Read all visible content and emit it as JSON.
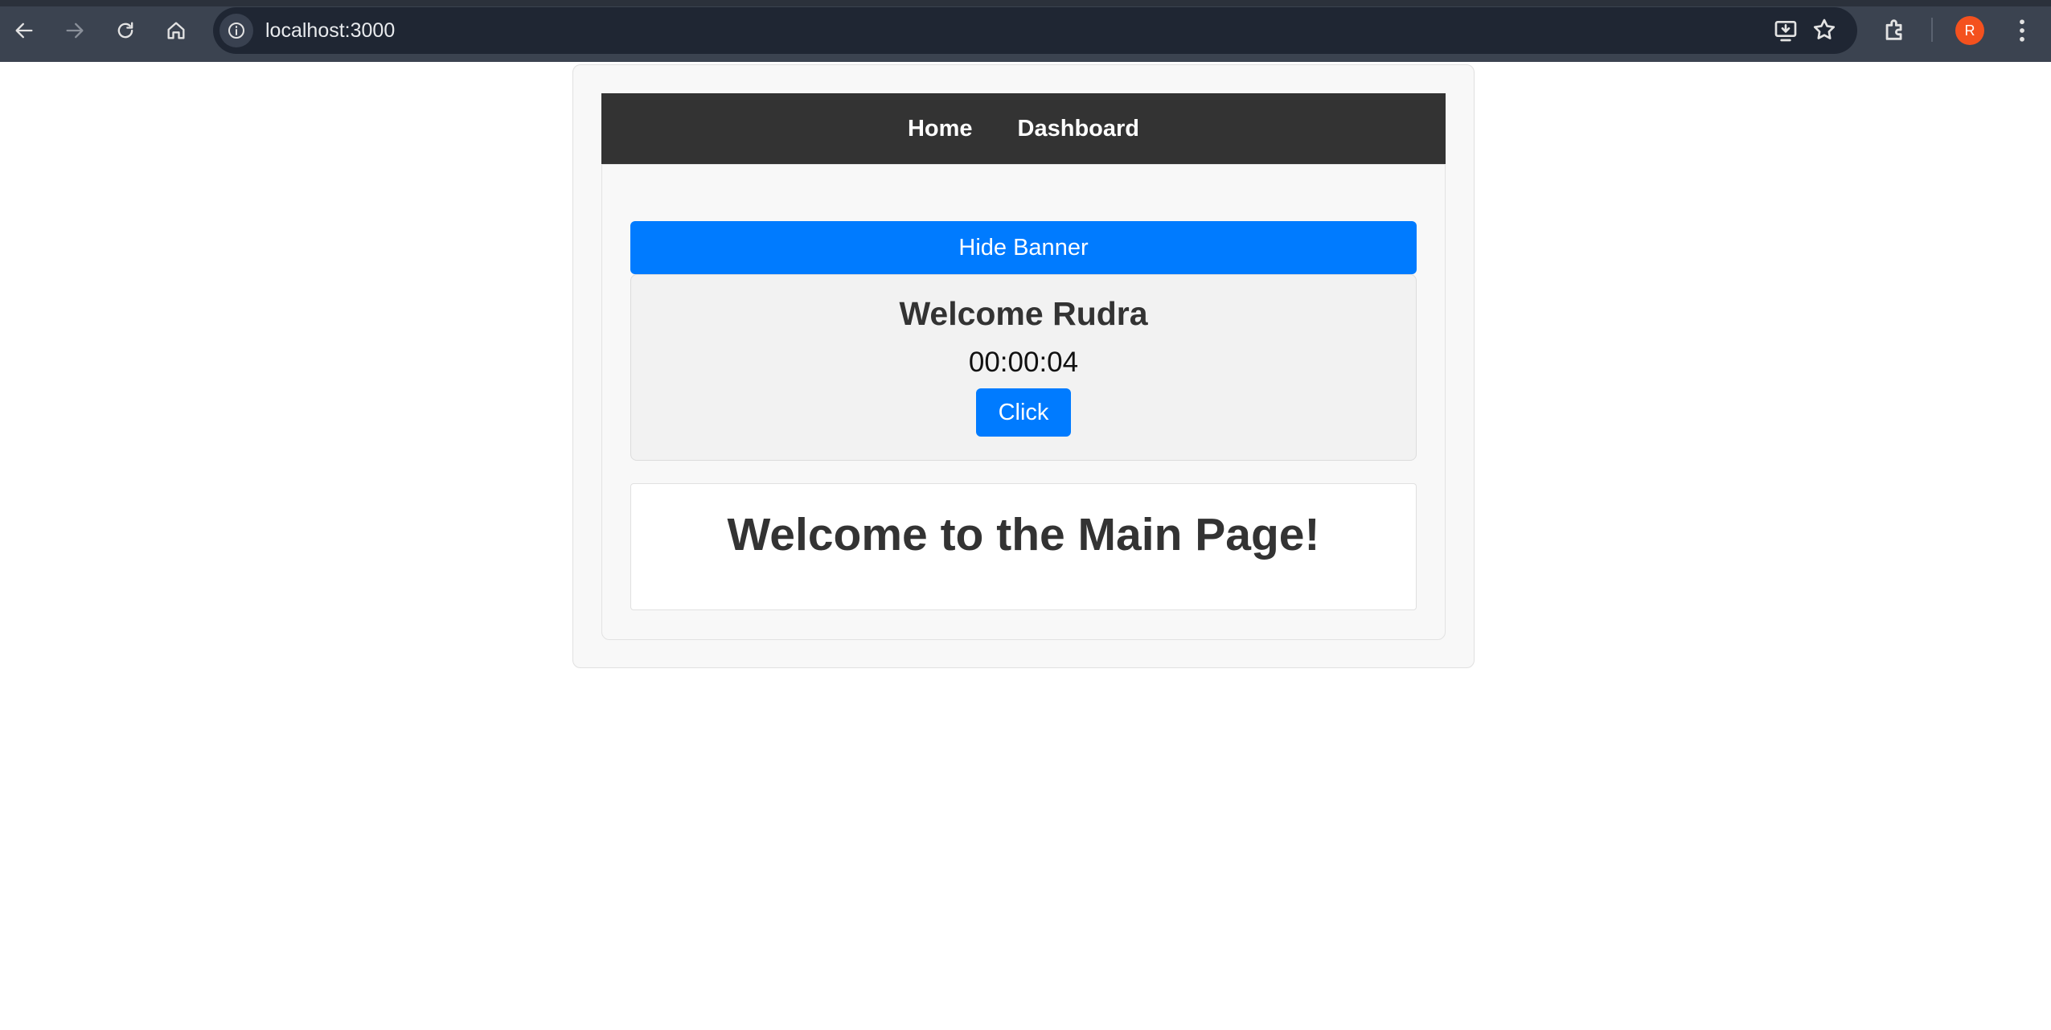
{
  "browser": {
    "url": "localhost:3000",
    "profile_initial": "R",
    "icons": [
      "back-arrow-icon",
      "forward-arrow-icon",
      "reload-icon",
      "home-icon",
      "site-info-icon",
      "install-app-icon",
      "bookmark-star-icon",
      "extensions-icon",
      "menu-dots-icon"
    ]
  },
  "navbar": {
    "items": [
      {
        "label": "Home"
      },
      {
        "label": "Dashboard"
      }
    ]
  },
  "banner": {
    "toggle_label": "Hide Banner",
    "greeting": "Welcome Rudra",
    "timer": "00:00:04",
    "click_label": "Click"
  },
  "main": {
    "heading": "Welcome to the Main Page!"
  },
  "colors": {
    "accent": "#007bff",
    "navbar_bg": "#333333",
    "avatar": "#f4511e"
  }
}
